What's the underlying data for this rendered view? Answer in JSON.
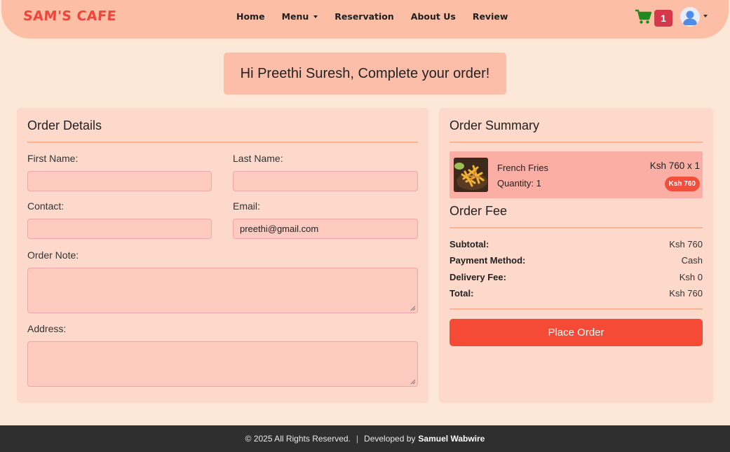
{
  "navbar": {
    "brand": "SAM'S CAFE",
    "links": [
      {
        "label": "Home"
      },
      {
        "label": "Menu",
        "dropdown": true
      },
      {
        "label": "Reservation"
      },
      {
        "label": "About Us"
      },
      {
        "label": "Review"
      }
    ],
    "cart_icon": "shopping-cart-icon",
    "cart_count": "1",
    "avatar_icon": "user-avatar-icon"
  },
  "greeting": "Hi Preethi Suresh, Complete your order!",
  "order_details": {
    "title": "Order Details",
    "first_name": {
      "label": "First Name:",
      "value": ""
    },
    "last_name": {
      "label": "Last Name:",
      "value": ""
    },
    "contact": {
      "label": "Contact:",
      "value": ""
    },
    "email": {
      "label": "Email:",
      "value": "preethi@gmail.com"
    },
    "order_note": {
      "label": "Order Note:",
      "value": ""
    },
    "address": {
      "label": "Address:",
      "value": ""
    }
  },
  "order_summary": {
    "title": "Order Summary",
    "items": [
      {
        "name": "French Fries",
        "quantity_text": "Quantity: 1",
        "price_text": "Ksh 760 x 1",
        "total_pill": "Ksh 760",
        "image_icon": "french-fries-image"
      }
    ],
    "fee_title": "Order Fee",
    "fees": [
      {
        "key": "Subtotal:",
        "value": "Ksh 760"
      },
      {
        "key": "Payment Method:",
        "value": "Cash"
      },
      {
        "key": "Delivery Fee:",
        "value": "Ksh 0"
      },
      {
        "key": "Total:",
        "value": "Ksh 760"
      }
    ],
    "place_order_label": "Place Order"
  },
  "footer": {
    "copyright": "© 2025 All Rights Reserved.",
    "separator": "|",
    "developed_by": "Developed by",
    "developer": "Samuel Wabwire"
  },
  "colors": {
    "page_bg": "#fde8d7",
    "navbar_bg": "#fcbea4",
    "brand": "#f0453a",
    "accent_button": "#f54a35",
    "cart_badge": "#d6384b",
    "cart_icon": "#1f8a1f",
    "footer_bg": "#2f2f2f"
  }
}
